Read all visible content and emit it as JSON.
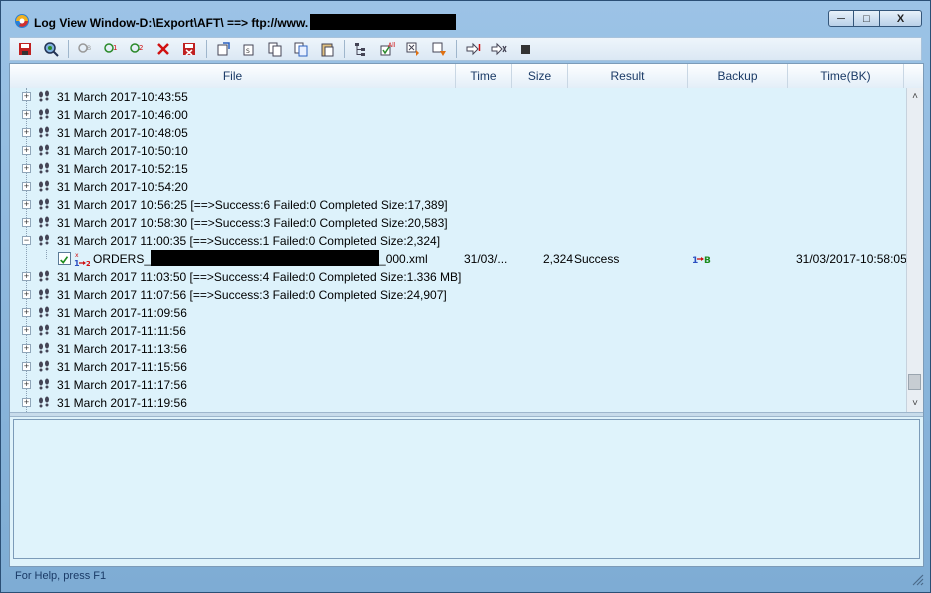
{
  "window": {
    "title": "Log View Window-D:\\Export\\AFT\\ ==> ftp://www.",
    "minimize_label": "─",
    "maximize_label": "□",
    "close_label": "X"
  },
  "columns": [
    "File",
    "Time",
    "Size",
    "Result",
    "Backup",
    "Time(BK)"
  ],
  "rows": [
    {
      "text": "31 March 2017-10:43:55",
      "expander": "+"
    },
    {
      "text": "31 March 2017-10:46:00",
      "expander": "+"
    },
    {
      "text": "31 March 2017-10:48:05",
      "expander": "+"
    },
    {
      "text": "31 March 2017-10:50:10",
      "expander": "+"
    },
    {
      "text": "31 March 2017-10:52:15",
      "expander": "+"
    },
    {
      "text": "31 March 2017-10:54:20",
      "expander": "+"
    },
    {
      "text": "31 March 2017 10:56:25 [==>Success:6 Failed:0 Completed Size:17,389]",
      "expander": "+"
    },
    {
      "text": "31 March 2017 10:58:30 [==>Success:3 Failed:0 Completed Size:20,583]",
      "expander": "+"
    },
    {
      "text": "31 March 2017 11:00:35 [==>Success:1 Failed:0 Completed Size:2,324]",
      "expander": "−"
    }
  ],
  "child_row": {
    "file_prefix": "ORDERS_",
    "file_suffix": "_000.xml",
    "time": "31/03/...",
    "size": "2,324",
    "result": "Success",
    "backup_icon": "upload-backup-icon",
    "time_bk": "31/03/2017-10:58:05"
  },
  "rows_after": [
    {
      "text": "31 March 2017 11:03:50 [==>Success:4 Failed:0 Completed Size:1.336 MB]",
      "expander": "+"
    },
    {
      "text": "31 March 2017 11:07:56 [==>Success:3 Failed:0 Completed Size:24,907]",
      "expander": "+"
    },
    {
      "text": "31 March 2017-11:09:56",
      "expander": "+"
    },
    {
      "text": "31 March 2017-11:11:56",
      "expander": "+"
    },
    {
      "text": "31 March 2017-11:13:56",
      "expander": "+"
    },
    {
      "text": "31 March 2017-11:15:56",
      "expander": "+"
    },
    {
      "text": "31 March 2017-11:17:56",
      "expander": "+"
    },
    {
      "text": "31 March 2017-11:19:56",
      "expander": "+"
    }
  ],
  "toolbar": {
    "icons": [
      "save-log-icon",
      "search-icon",
      "search-all-icon",
      "search-next-icon",
      "search-prev-icon",
      "delete-icon",
      "delete-log-icon",
      "export-icon",
      "export-selected-icon",
      "copy-icon",
      "copy-all-icon",
      "paste-icon",
      "tree-view-icon",
      "check-all-icon",
      "filter-icon",
      "filter-down-icon",
      "goto-icon",
      "skip-icon",
      "stop-icon"
    ]
  },
  "status": {
    "help_text": "For Help, press F1"
  },
  "colors": {
    "tree_bg": "#ddf2fb",
    "header_text": "#1a3a66",
    "success_green": "#1c8c1c",
    "error_red": "#d01010"
  }
}
